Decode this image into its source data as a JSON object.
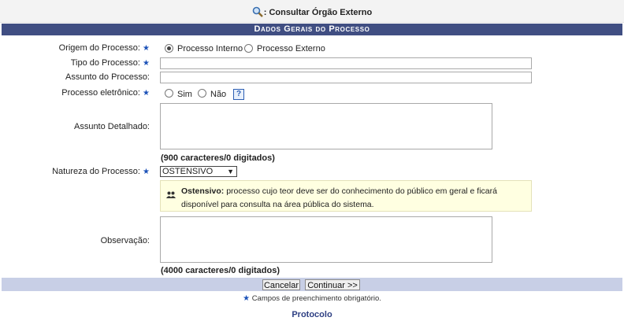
{
  "header": {
    "title": ": Consultar Órgão Externo",
    "icon": "magnifier-icon"
  },
  "section": {
    "title": "Dados Gerais do Processo"
  },
  "form": {
    "origem": {
      "label": "Origem do Processo:",
      "options": [
        "Processo Interno",
        "Processo Externo"
      ],
      "selected": "Processo Interno"
    },
    "tipo": {
      "label": "Tipo do Processo:",
      "value": ""
    },
    "assunto": {
      "label": "Assunto do Processo:",
      "value": ""
    },
    "eletronico": {
      "label": "Processo eletrônico:",
      "options": [
        "Sim",
        "Não"
      ],
      "selected": "",
      "help": "?"
    },
    "assunto_detalhado": {
      "label": "Assunto Detalhado:",
      "value": "",
      "counter": "(900 caracteres/0 digitados)"
    },
    "natureza": {
      "label": "Natureza do Processo:",
      "selected": "OSTENSIVO",
      "arrow": "▼",
      "info_term": "Ostensivo:",
      "info_text": "processo cujo teor deve ser do conhecimento do público em geral e ficará disponível para consulta na área pública do sistema."
    },
    "observacao": {
      "label": "Observação:",
      "value": "",
      "counter": "(4000 caracteres/0 digitados)"
    },
    "required_mark": "★"
  },
  "buttons": {
    "cancel": "Cancelar",
    "continue": "Continuar >>"
  },
  "footer": {
    "required_note": "Campos de preenchimento obrigatório.",
    "link": "Protocolo"
  },
  "colors": {
    "section_bg": "#404e82",
    "footer_bar": "#c8cfe6",
    "info_bg": "#ffffe1",
    "link": "#2e3f83"
  }
}
